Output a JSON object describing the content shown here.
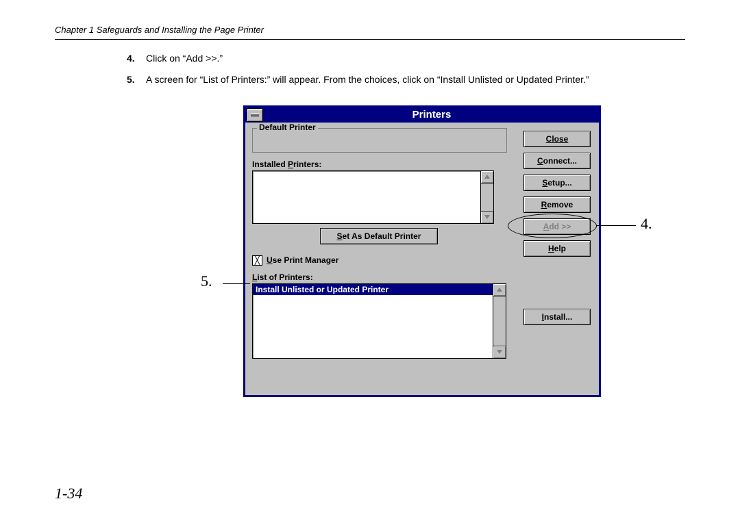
{
  "header": {
    "chapter": "Chapter 1 Safeguards and Installing the Page Printer"
  },
  "steps": [
    {
      "num": "4.",
      "text": "Click on “Add >>.”"
    },
    {
      "num": "5.",
      "text": "A screen for “List of Printers:” will appear.  From the choices, click on “Install Unlisted or Updated Printer.”"
    }
  ],
  "dialog": {
    "title": "Printers",
    "default_printer_label": "Default Printer",
    "installed_label_pre": "Installed ",
    "installed_label_u": "P",
    "installed_label_post": "rinters:",
    "set_default_u": "S",
    "set_default_post": "et As Default Printer",
    "use_pm_u": "U",
    "use_pm_post": "se Print Manager",
    "chk_mark": "╳",
    "list_label_u": "L",
    "list_label_post": "ist of Printers:",
    "selected_item": "Install Unlisted or Updated Printer",
    "buttons": {
      "close": "Close",
      "connect_u": "C",
      "connect_post": "onnect...",
      "setup_u": "S",
      "setup_post": "etup...",
      "remove_u": "R",
      "remove_post": "emove",
      "add_u": "A",
      "add_post": "dd >>",
      "help_u": "H",
      "help_post": "elp",
      "install_u": "I",
      "install_post": "nstall..."
    }
  },
  "callouts": {
    "c4": "4.",
    "c5": "5."
  },
  "page_number": "1-34"
}
